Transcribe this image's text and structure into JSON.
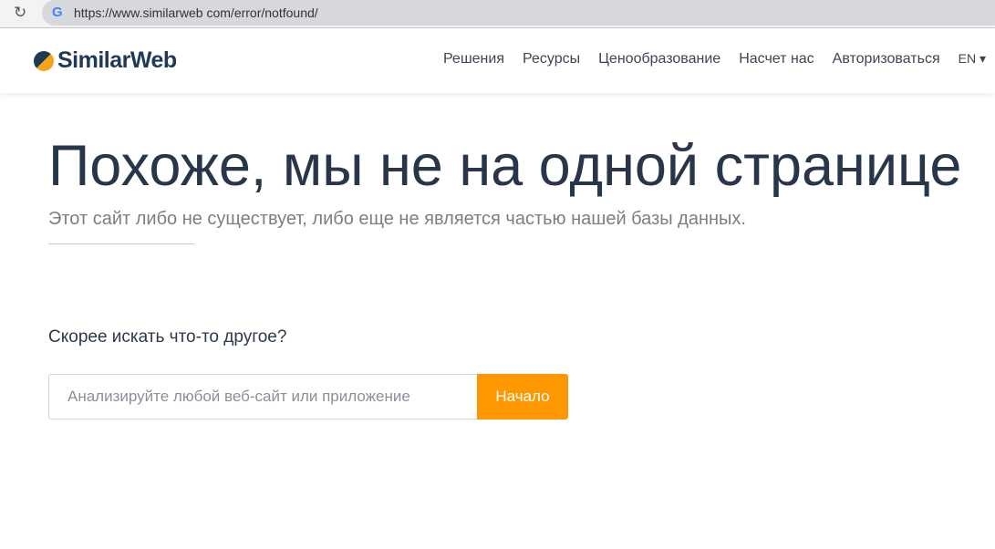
{
  "browser": {
    "url": "https://www.similarweb com/error/notfound/"
  },
  "header": {
    "logo": "SimilarWeb",
    "nav": [
      "Решения",
      "Ресурсы",
      "Ценообразование",
      "Насчет нас",
      "Авторизоваться"
    ],
    "lang": "EN ▾"
  },
  "main": {
    "title": "Похоже, мы не на одной странице",
    "subtitle": "Этот сайт либо не существует, либо еще не является частью нашей базы данных.",
    "prompt": "Скорее искать что-то другое?",
    "search_placeholder": "Анализируйте любой веб-сайт или приложение",
    "search_button": "Начало"
  },
  "colors": {
    "accent": "#ff9800",
    "title": "#283649"
  }
}
